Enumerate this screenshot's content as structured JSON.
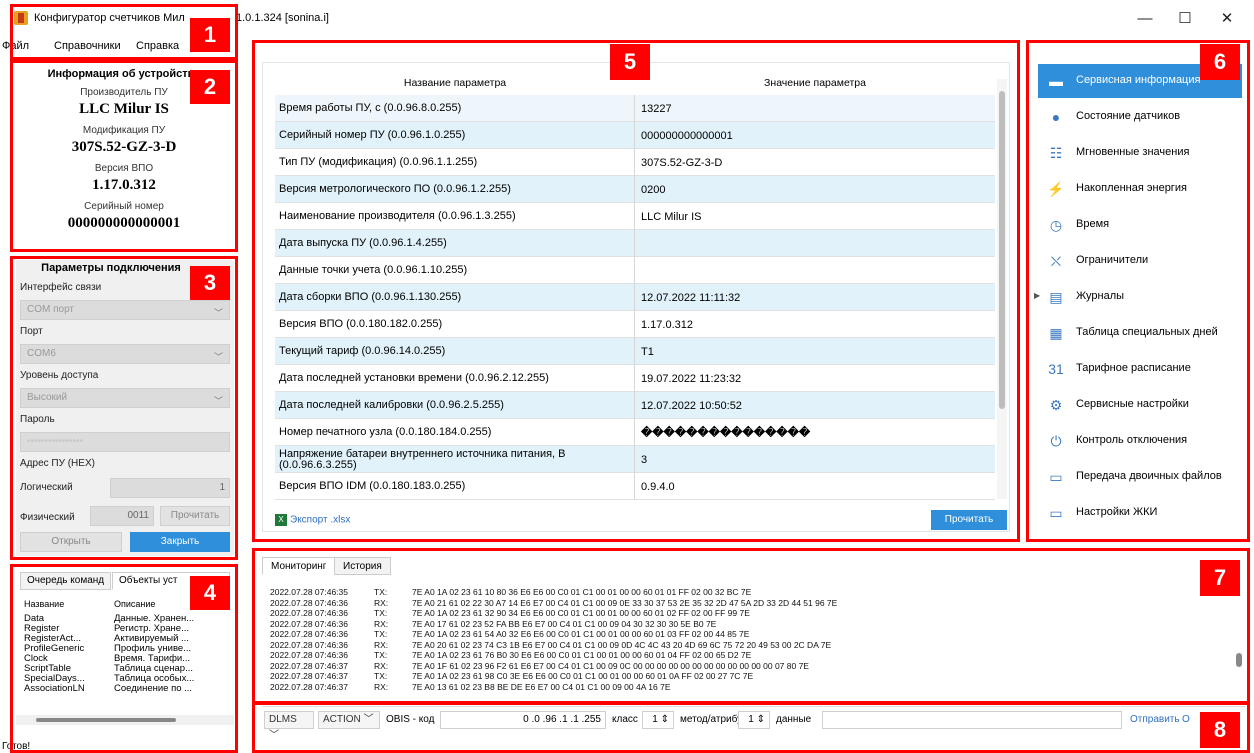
{
  "window": {
    "title_left": "Конфигуратор счетчиков Мил",
    "title_right": "1.0.1.324 [sonina.i]",
    "minimize": "—",
    "maximize": "☐",
    "close": "✕"
  },
  "menu": [
    "Файл",
    "Справочники",
    "Справка"
  ],
  "device_info": {
    "title": "Информация об устройстве",
    "manufacturer_label": "Производитель ПУ",
    "manufacturer": "LLC Milur IS",
    "model_label": "Модификация ПУ",
    "model": "307S.52-GZ-3-D",
    "fw_label": "Версия ВПО",
    "fw": "1.17.0.312",
    "serial_label": "Серийный номер",
    "serial": "000000000000001"
  },
  "connection": {
    "title": "Параметры подключения",
    "interface_label": "Интерфейс связи",
    "interface_value": "COM порт",
    "port_label": "Порт",
    "port_value": "COM6",
    "access_label": "Уровень доступа",
    "access_value": "Высокий",
    "password_label": "Пароль",
    "password_value": "••••••••••••••••",
    "address_label": "Адрес ПУ (HEX)",
    "logical_label": "Логический",
    "logical_value": "1",
    "physical_label": "Физический",
    "physical_value": "0011",
    "read_button": "Прочитать",
    "open_button": "Открыть",
    "close_button": "Закрыть"
  },
  "commands": {
    "tabs": [
      "Очередь команд",
      "Объекты уст"
    ],
    "col_name": "Название",
    "col_desc": "Описание",
    "rows": [
      {
        "name": "Data",
        "desc": "Данные. Хранен..."
      },
      {
        "name": "Register",
        "desc": "Регистр. Хране..."
      },
      {
        "name": "RegisterAct...",
        "desc": "Активируемый ..."
      },
      {
        "name": "ProfileGeneric",
        "desc": "Профиль униве..."
      },
      {
        "name": "Clock",
        "desc": "Время. Тарифи..."
      },
      {
        "name": "ScriptTable",
        "desc": "Таблица сценар..."
      },
      {
        "name": "SpecialDays...",
        "desc": "Таблица особых..."
      },
      {
        "name": "AssociationLN",
        "desc": "Соединение по ..."
      }
    ]
  },
  "status": "Готов!",
  "params": {
    "col_name": "Название параметра",
    "col_value": "Значение параметра",
    "rows": [
      {
        "name": "Время работы ПУ, с (0.0.96.8.0.255)",
        "value": "13227"
      },
      {
        "name": "Серийный номер ПУ (0.0.96.1.0.255)",
        "value": "000000000000001"
      },
      {
        "name": "Тип ПУ (модификация) (0.0.96.1.1.255)",
        "value": "307S.52-GZ-3-D"
      },
      {
        "name": "Версия метрологического ПО (0.0.96.1.2.255)",
        "value": "0200"
      },
      {
        "name": "Наименование производителя (0.0.96.1.3.255)",
        "value": "LLC Milur IS"
      },
      {
        "name": "Дата выпуска ПУ (0.0.96.1.4.255)",
        "value": ""
      },
      {
        "name": "Данные точки учета (0.0.96.1.10.255)",
        "value": ""
      },
      {
        "name": "Дата сборки ВПО (0.0.96.1.130.255)",
        "value": "12.07.2022 11:11:32"
      },
      {
        "name": "Версия ВПО (0.0.180.182.0.255)",
        "value": "1.17.0.312"
      },
      {
        "name": "Текущий тариф (0.0.96.14.0.255)",
        "value": "T1"
      },
      {
        "name": "Дата последней установки времени (0.0.96.2.12.255)",
        "value": "19.07.2022 11:23:32"
      },
      {
        "name": "Дата последней калибровки (0.0.96.2.5.255)",
        "value": "12.07.2022 10:50:52"
      },
      {
        "name": "Номер печатного узла (0.0.180.184.0.255)",
        "value": "���������������"
      },
      {
        "name": "Напряжение батареи внутреннего источника питания, В (0.0.96.6.3.255)",
        "value": "3"
      },
      {
        "name": "Версия ВПО IDM (0.0.180.183.0.255)",
        "value": "0.9.4.0"
      }
    ],
    "export": "Экспорт .xlsx",
    "read_button": "Прочитать"
  },
  "nav": [
    {
      "label": "Сервисная информация",
      "icon": "service-info-icon",
      "glyph": "▬"
    },
    {
      "label": "Состояние датчиков",
      "icon": "sensor-icon",
      "glyph": "●"
    },
    {
      "label": "Мгновенные значения",
      "icon": "binary-icon",
      "glyph": "☷"
    },
    {
      "label": "Накопленная энергия",
      "icon": "energy-icon",
      "glyph": "⚡"
    },
    {
      "label": "Время",
      "icon": "clock-icon",
      "glyph": "◷"
    },
    {
      "label": "Ограничители",
      "icon": "barrier-icon",
      "glyph": "⛌"
    },
    {
      "label": "Журналы",
      "icon": "journal-icon",
      "glyph": "▤"
    },
    {
      "label": "Таблица специальных дней",
      "icon": "calendar-icon",
      "glyph": "▦"
    },
    {
      "label": "Тарифное расписание",
      "icon": "calendar-31-icon",
      "glyph": "31"
    },
    {
      "label": "Сервисные настройки",
      "icon": "code-settings-icon",
      "glyph": "⚙"
    },
    {
      "label": "Контроль отключения",
      "icon": "switch-icon",
      "glyph": "⏻"
    },
    {
      "label": "Передача двоичных файлов",
      "icon": "printer-icon",
      "glyph": "▭"
    },
    {
      "label": "Настройки ЖКИ",
      "icon": "lcd-icon",
      "glyph": "▭"
    }
  ],
  "monitor": {
    "tabs": [
      "Мониторинг",
      "История"
    ],
    "lines": [
      {
        "ts": "2022.07.28 07:46:35",
        "dir": "TX:",
        "hex": "7E A0 1A 02 23 61 10 80 36 E6 E6 00 C0 01 C1 00 01 00 00 60 01 01 FF 02 00 32 BC 7E"
      },
      {
        "ts": "2022.07.28 07:46:36",
        "dir": "RX:",
        "hex": "7E A0 21 61 02 22 30 A7 14 E6 E7 00 C4 01 C1 00 09 0E 33 30 37 53 2E 35 32 2D 47 5A 2D 33 2D 44 51 96 7E"
      },
      {
        "ts": "2022.07.28 07:46:36",
        "dir": "TX:",
        "hex": "7E A0 1A 02 23 61 32 90 34 E6 E6 00 C0 01 C1 00 01 00 00 60 01 02 FF 02 00 FF 99 7E"
      },
      {
        "ts": "2022.07.28 07:46:36",
        "dir": "RX:",
        "hex": "7E A0 17 61 02 23 52 FA BB E6 E7 00 C4 01 C1 00 09 04 30 32 30 30 5E B0 7E"
      },
      {
        "ts": "2022.07.28 07:46:36",
        "dir": "TX:",
        "hex": "7E A0 1A 02 23 61 54 A0 32 E6 E6 00 C0 01 C1 00 01 00 00 60 01 03 FF 02 00 44 85 7E"
      },
      {
        "ts": "2022.07.28 07:46:36",
        "dir": "RX:",
        "hex": "7E A0 20 61 02 23 74 C3 1B E6 E7 00 C4 01 C1 00 09 0D 4C 4C 43 20 4D 69 6C 75 72 20 49 53 00 2C DA 7E"
      },
      {
        "ts": "2022.07.28 07:46:36",
        "dir": "TX:",
        "hex": "7E A0 1A 02 23 61 76 B0 30 E6 E6 00 C0 01 C1 00 01 00 00 60 01 04 FF 02 00 65 D2 7E"
      },
      {
        "ts": "2022.07.28 07:46:37",
        "dir": "RX:",
        "hex": "7E A0 1F 61 02 23 96 F2 61 E6 E7 00 C4 01 C1 00 09 0C 00 00 00 00 00 00 00 00 00 00 00 00 07 80 7E"
      },
      {
        "ts": "2022.07.28 07:46:37",
        "dir": "TX:",
        "hex": "7E A0 1A 02 23 61 98 C0 3E E6 E6 00 C0 01 C1 00 01 00 00 60 01 0A FF 02 00 27 7C 7E"
      },
      {
        "ts": "2022.07.28 07:46:37",
        "dir": "RX:",
        "hex": "7E A0 13 61 02 23 B8 BE DE E6 E7 00 C4 01 C1 00 09 00 4A 16 7E"
      }
    ]
  },
  "cmdline": {
    "protocol": "DLMS",
    "action": "ACTION",
    "obis_label": "OBIS - код",
    "obis_value": "0 .0 .96 .1 .1 .255",
    "class_label": "класс",
    "class_value": "1",
    "method_label": "метод/атрибут",
    "method_value": "1",
    "data_label": "данные",
    "send": "Отправить",
    "send_tail": "О"
  },
  "callouts": [
    "1",
    "2",
    "3",
    "4",
    "5",
    "6",
    "7",
    "8"
  ],
  "colors": {
    "callout": "#ff0000",
    "accent": "#2f8fdb",
    "row_alt": "#e1f2fa"
  }
}
